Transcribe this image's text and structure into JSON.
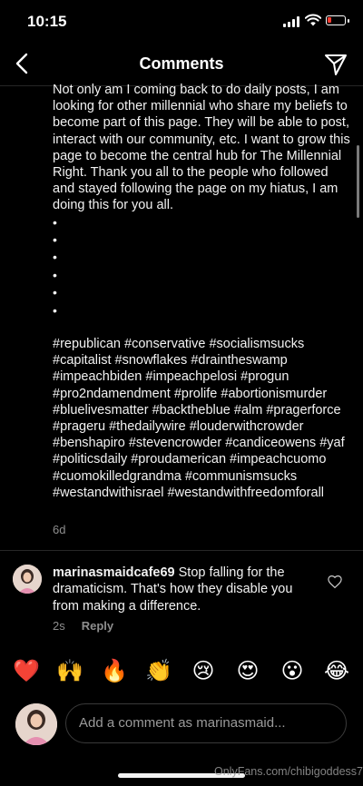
{
  "status_bar": {
    "time": "10:15"
  },
  "nav": {
    "title": "Comments"
  },
  "post": {
    "body": "Not only am I coming back to do daily posts, I am looking for other millennial who share my beliefs to become part of this page. They will be able to post, interact with our community, etc. I want to grow this page to become the central hub for The Millennial Right. Thank you all to the people who followed and stayed following the page on my hiatus, I am doing this for you all.",
    "dots": [
      "•",
      "•",
      "•",
      "•",
      "•",
      "•"
    ],
    "hashtags": " #republican #conservative #socialismsucks #capitalist #snowflakes #draintheswamp #impeachbiden #impeachpelosi #progun #pro2ndamendment #prolife #abortionismurder #bluelivesmatter #backtheblue #alm #pragerforce #prageru #thedailywire #louderwithcrowder #benshapiro #stevencrowder #candiceowens #yaf #politicsdaily #proudamerican #impeachcuomo #cuomokilledgrandma #communismsucks #westandwithisrael #westandwithfreedomforall",
    "time": "6d"
  },
  "comment": {
    "username": "marinasmaidcafe69",
    "text": " Stop falling for the dramaticism. That's how they disable you from making a difference.",
    "time": "2s",
    "reply_label": "Reply"
  },
  "emoji_bar": [
    "❤️",
    "🙌",
    "🔥",
    "👏",
    "😢",
    "😍",
    "😮",
    "😂"
  ],
  "composer": {
    "placeholder": "Add a comment as marinasmaid..."
  },
  "watermark": "OnlyFans.com/chibigoddess7",
  "colors": {
    "background": "#000000",
    "muted": "#8e8e8e",
    "divider": "#262626"
  }
}
